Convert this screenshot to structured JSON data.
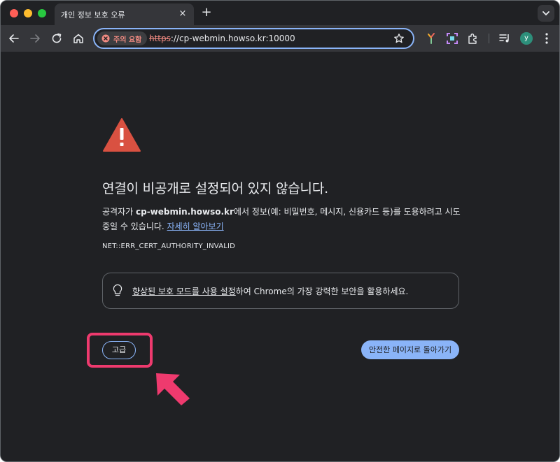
{
  "window": {
    "tab_title": "개인 정보 보호 오류",
    "tab_close": "×",
    "new_tab": "+"
  },
  "toolbar": {
    "security_chip": "주의 요함",
    "url_scheme": "https",
    "url_rest": "://cp-webmin.howso.kr:10000",
    "avatar_letter": "y"
  },
  "page": {
    "heading": "연결이 비공개로 설정되어 있지 않습니다.",
    "body_prefix": "공격자가 ",
    "body_host": "cp-webmin.howso.kr",
    "body_suffix": "에서 정보(예: 비밀번호, 메시지, 신용카드 등)를 도용하려고 시도 중일 수 있습니다. ",
    "learn_more": "자세히 알아보기",
    "error_code": "NET::ERR_CERT_AUTHORITY_INVALID",
    "protection_link": "향상된 보호 모드를 사용 설정",
    "protection_suffix": "하여 Chrome의 가장 강력한 보안을 활용하세요.",
    "advanced_button": "고급",
    "back_button": "안전한 페이지로 돌아가기"
  },
  "colors": {
    "accent": "#8ab4f8",
    "warning": "#d95141",
    "highlight": "#ee3a6e",
    "background": "#202124"
  }
}
